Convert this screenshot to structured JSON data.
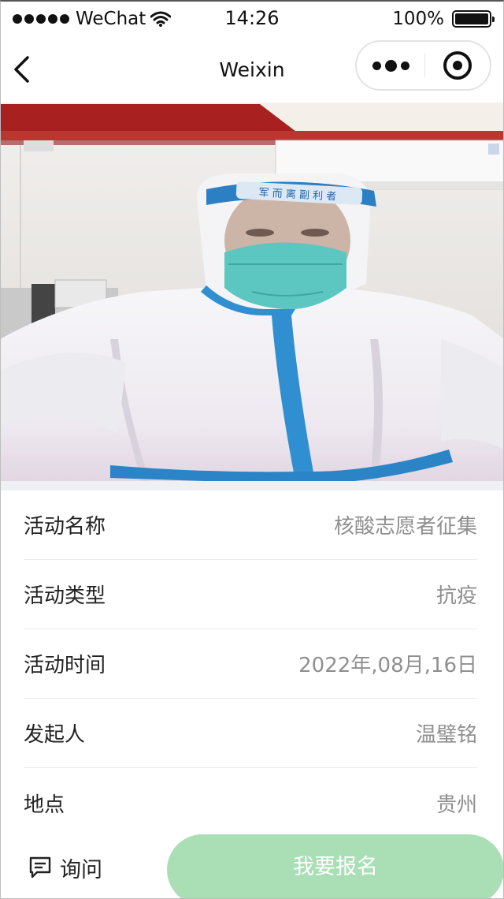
{
  "status_bar": {
    "carrier": "WeChat",
    "time": "14:26",
    "battery": "100%",
    "icons": [
      "signal-dots-icon",
      "wifi-icon",
      "battery-icon"
    ]
  },
  "nav": {
    "title": "Weixin",
    "icons": [
      "back-arrow-icon",
      "more-dots-icon",
      "close-target-icon"
    ]
  },
  "photo": {
    "faceshield_text": "军 而 离 副 利 者"
  },
  "info": [
    {
      "label": "活动名称",
      "value": "核酸志愿者征集"
    },
    {
      "label": "活动类型",
      "value": "抗疫"
    },
    {
      "label": "活动时间",
      "value": "2022年,08月,16日"
    },
    {
      "label": "发起人",
      "value": "温璧铭"
    },
    {
      "label": "地点",
      "value": "贵州"
    }
  ],
  "bottom": {
    "inquire_label": "询问",
    "enroll_label": "我要报名",
    "inquire_icon": "message-icon"
  },
  "colors": {
    "enroll_button": "#aadfb6",
    "value_text": "#8f8f8f"
  }
}
